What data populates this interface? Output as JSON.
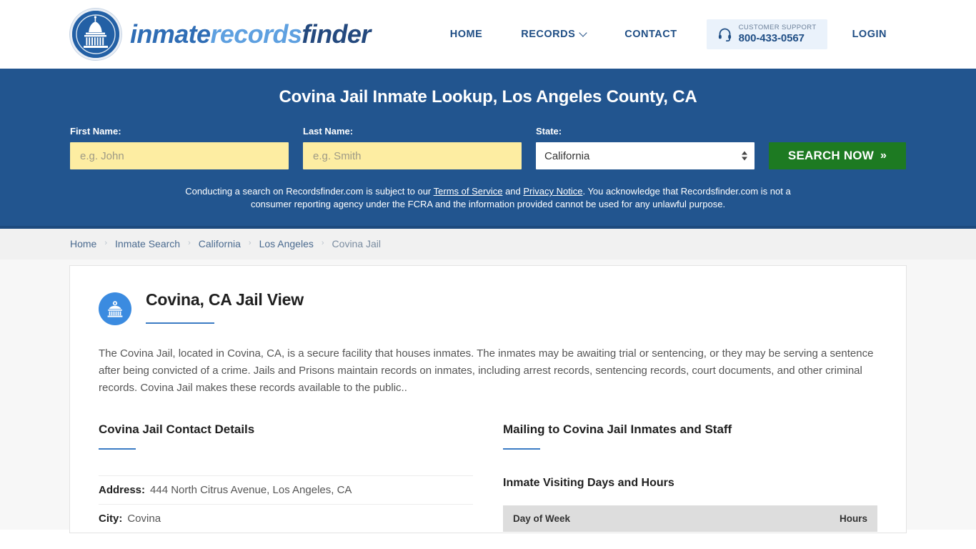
{
  "header": {
    "brand": {
      "part1": "inmate",
      "part2": "records",
      "part3": "finder"
    },
    "nav": [
      {
        "label": "HOME",
        "name": "nav-home",
        "caret": false
      },
      {
        "label": "RECORDS",
        "name": "nav-records",
        "caret": true
      },
      {
        "label": "CONTACT",
        "name": "nav-contact",
        "caret": false
      }
    ],
    "support": {
      "label": "CUSTOMER SUPPORT",
      "phone": "800-433-0567",
      "icon": "headset-icon"
    },
    "login_label": "LOGIN"
  },
  "banner": {
    "title": "Covina Jail Inmate Lookup, Los Angeles County, CA",
    "first_name_label": "First Name:",
    "first_name_placeholder": "e.g. John",
    "first_name_value": "",
    "last_name_label": "Last Name:",
    "last_name_placeholder": "e.g. Smith",
    "last_name_value": "",
    "state_label": "State:",
    "state_value": "California",
    "state_options": [
      "California"
    ],
    "search_button": "SEARCH NOW",
    "search_button_chevron": "»",
    "disclaimer_part1": "Conducting a search on Recordsfinder.com is subject to our ",
    "disclaimer_link1": "Terms of Service",
    "disclaimer_mid": " and ",
    "disclaimer_link2": "Privacy Notice",
    "disclaimer_part2": ". You acknowledge that Recordsfinder.com is not a consumer reporting agency under the FCRA and the information provided cannot be used for any unlawful purpose.",
    "bg_color": "#22558F",
    "button_color": "#1D7A22",
    "input_color": "#FDEDA2"
  },
  "breadcrumb": {
    "separator": "›",
    "items": [
      {
        "label": "Home",
        "current": false
      },
      {
        "label": "Inmate Search",
        "current": false
      },
      {
        "label": "California",
        "current": false
      },
      {
        "label": "Los Angeles",
        "current": false
      },
      {
        "label": "Covina Jail",
        "current": true
      }
    ]
  },
  "main": {
    "icon": "jail-building-icon",
    "title": "Covina, CA Jail View",
    "intro": "The Covina Jail, located in Covina, CA, is a secure facility that houses inmates. The inmates may be awaiting trial or sentencing, or they may be serving a sentence after being convicted of a crime. Jails and Prisons maintain records on inmates, including arrest records, sentencing records, court documents, and other criminal records. Covina Jail makes these records available to the public..",
    "left": {
      "section_title": "Covina Jail Contact Details",
      "rows": [
        {
          "key": "Address:",
          "value": "444 North Citrus Avenue, Los Angeles, CA"
        },
        {
          "key": "City:",
          "value": "Covina"
        }
      ]
    },
    "right": {
      "section_title": "Mailing to Covina Jail Inmates and Staff",
      "sub_title": "Inmate Visiting Days and Hours",
      "table": {
        "columns": [
          "Day of Week",
          "Hours"
        ],
        "rows": []
      }
    },
    "accent_color": "#3B7CC4"
  }
}
